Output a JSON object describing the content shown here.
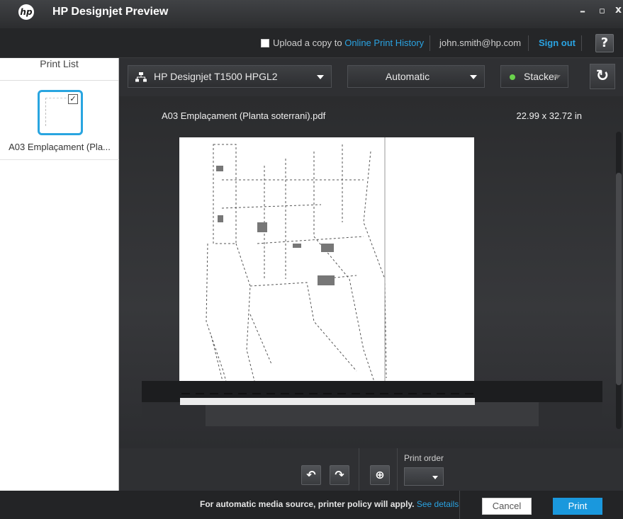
{
  "titlebar": {
    "logo_text": "hp",
    "title": "HP Designjet Preview",
    "minimize": "–",
    "maximize": "▫",
    "close": "x"
  },
  "accountbar": {
    "upload_prefix": "Upload a copy to",
    "upload_link": "Online Print History",
    "email": "john.smith@hp.com",
    "sign_out": "Sign out",
    "help": "?"
  },
  "print_list": {
    "header": "Print List",
    "items": [
      {
        "label": "A03 Emplaçament (Pla...",
        "checked": true
      }
    ]
  },
  "toolbar": {
    "printer": "HP Designjet T1500 HPGL2",
    "source": "Automatic",
    "output": "Stacker",
    "output_status_color": "#6ad24c"
  },
  "preview": {
    "filename": "A03 Emplaçament (Planta soterrani).pdf",
    "size": "22.99 x 32.72 in"
  },
  "controls": {
    "rotate_left": "↶",
    "rotate_right": "↷",
    "center": "⊕",
    "print_order_label": "Print order",
    "print_order_value": ""
  },
  "status": {
    "message": "For automatic media source, printer policy will apply.",
    "link": "See details",
    "cancel": "Cancel",
    "print": "Print"
  }
}
